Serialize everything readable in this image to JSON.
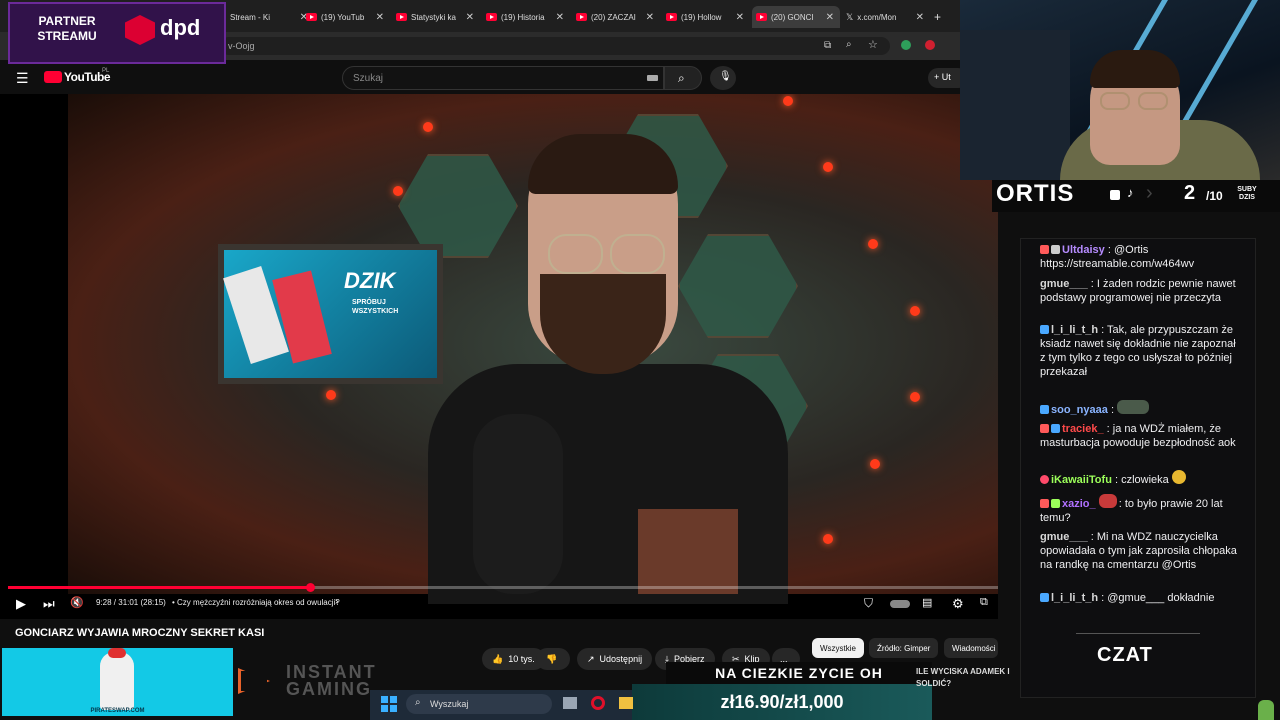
{
  "browser": {
    "tabs": [
      {
        "label": "Stream - Ki",
        "icon": "kick-icon"
      },
      {
        "label": "(19) YouTub",
        "icon": "youtube-icon"
      },
      {
        "label": "Statystyki ka",
        "icon": "youtube-icon"
      },
      {
        "label": "(19) Historia",
        "icon": "youtube-icon"
      },
      {
        "label": "(20) ZACZAI",
        "icon": "youtube-icon"
      },
      {
        "label": "(19) Hollow",
        "icon": "youtube-icon"
      },
      {
        "label": "(20) GONCI",
        "icon": "youtube-icon",
        "active": true
      },
      {
        "label": "x.com/Mon",
        "icon": "x-icon"
      }
    ],
    "url_fragment": "v-Oojg"
  },
  "youtube": {
    "logo": "YouTube",
    "region": "PL",
    "search_placeholder": "Szukaj",
    "create_label": "Ut"
  },
  "video": {
    "time": "9:28 / 31:01 (28:15)",
    "chapter": "• Czy mężczyźni rozróżniają okres od owulacji?",
    "progress": 0.305,
    "poster_brand": "DZIK",
    "poster_tagline": "SPRÓBUJ WSZYSTKICH",
    "title": "GONCIARZ WYJAWIA MROCZNY SEKRET KASI",
    "likes": "10 tys.",
    "share_label": "Udostępnij",
    "download_label": "Pobierz",
    "clip_label": "Klip",
    "more_label": "...",
    "filters": [
      "Wszystkie",
      "Źródło: Gimper",
      "Wiadomości ze"
    ]
  },
  "overlay": {
    "partner_text": "PARTNER STREAMU",
    "sponsor_name": "dpd",
    "streamer": "ORTIS",
    "subs_current": "2",
    "subs_goal": "/10",
    "subs_label": "SUBY DZIS",
    "promo_site": "PIRATESWAP.COM",
    "instant_gaming": "INSTANT GAMING",
    "ticker": "NA CIEZKIE ZYCIE OH",
    "money": "zł16.90/zł1,000",
    "news": "ILE WYCISKA ADAMEK I SOLDIĆ?",
    "czat_label": "CZAT"
  },
  "taskbar": {
    "search_label": "Wyszukaj"
  },
  "chat": [
    {
      "user": "Ultdaisy",
      "color": "#b68cff",
      "text": ": @Ortis https://streamable.com/w464wv"
    },
    {
      "user": "gmue___",
      "color": "#d8d8d8",
      "text": ": I żaden rodzic pewnie nawet podstawy programowej nie przeczyta"
    },
    {
      "user": "l_i_li_t_h",
      "color": "#d8d8d8",
      "text": ": Tak, ale przypuszczam że ksiadz nawet się dokładnie nie zapoznał z tym tylko z tego co usłyszał to później przekazał"
    },
    {
      "user": "soo_nyaaa",
      "color": "#8ab4ff",
      "text": ":"
    },
    {
      "user": "traciek_",
      "color": "#ff4a4a",
      "text": ": ja na WDŻ miałem, że masturbacja powoduje bezpłodność aok"
    },
    {
      "user": "iKawaiiTofu",
      "color": "#9cff5a",
      "text": ": czlowieka"
    },
    {
      "user": "xazio_",
      "color": "#b070ff",
      "text": ": to było prawie 20 lat temu?"
    },
    {
      "user": "gmue___",
      "color": "#d8d8d8",
      "text": ": Mi na WDZ nauczycielka opowiadała o tym jak zaprosiła chłopaka na randkę na cmentarzu @Ortis"
    },
    {
      "user": "l_i_li_t_h",
      "color": "#d8d8d8",
      "text": ": @gmue___ dokładnie"
    }
  ]
}
